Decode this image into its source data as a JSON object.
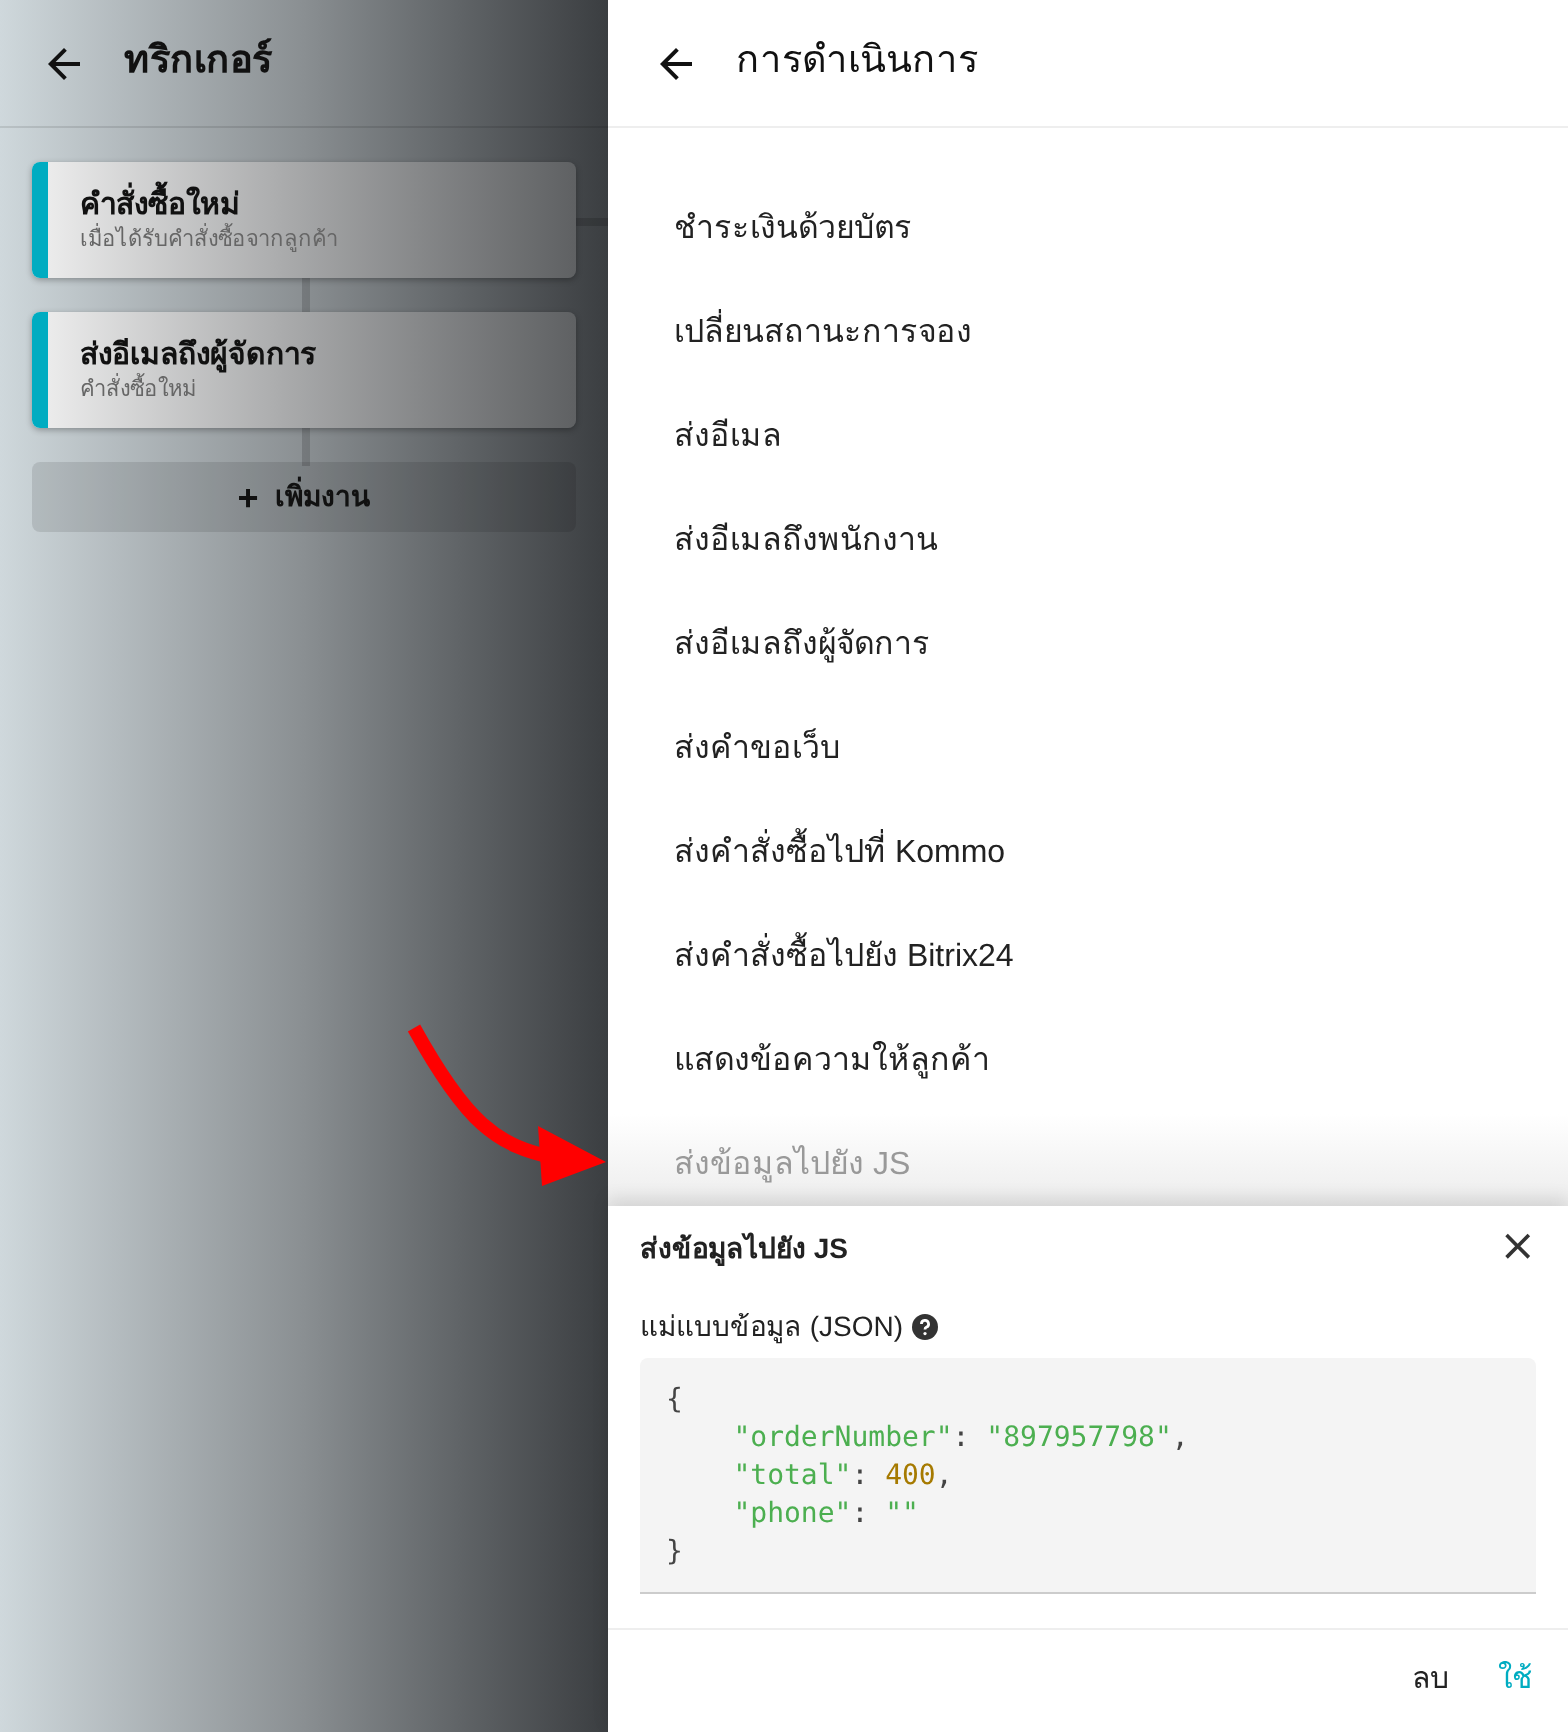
{
  "triggers_panel": {
    "title": "ทริกเกอร์",
    "tasks": [
      {
        "title": "คำสั่งซื้อใหม่",
        "subtitle": "เมื่อได้รับคำสั่งซื้อจากลูกค้า",
        "color": "#00acc1"
      },
      {
        "title": "ส่งอีเมลถึงผู้จัดการ",
        "subtitle": "คำสั่งซื้อใหม่",
        "color": "#00acc1"
      }
    ],
    "add_button": {
      "icon": "+",
      "label": "เพิ่มงาน"
    }
  },
  "actions_panel": {
    "title": "การดำเนินการ",
    "items": [
      {
        "label": "ชำระเงินด้วยบัตร",
        "selected": false
      },
      {
        "label": "เปลี่ยนสถานะการจอง",
        "selected": false
      },
      {
        "label": "ส่งอีเมล",
        "selected": false
      },
      {
        "label": "ส่งอีเมลถึงพนักงาน",
        "selected": false
      },
      {
        "label": "ส่งอีเมลถึงผู้จัดการ",
        "selected": false
      },
      {
        "label": "ส่งคำขอเว็บ",
        "selected": false
      },
      {
        "label": "ส่งคำสั่งซื้อไปที่ Kommo",
        "selected": false
      },
      {
        "label": "ส่งคำสั่งซื้อไปยัง Bitrix24",
        "selected": false
      },
      {
        "label": "แสดงข้อความให้ลูกค้า",
        "selected": false
      },
      {
        "label": "ส่งข้อมูลไปยัง JS",
        "selected": true
      }
    ]
  },
  "dialog": {
    "title": "ส่งข้อมูลไปยัง JS",
    "close": "×",
    "field_label": "แม่แบบข้อมูล (JSON)",
    "code_lines": [
      [
        {
          "kind": "punct",
          "text": "{"
        }
      ],
      [
        {
          "kind": "key",
          "text": "    \"orderNumber\""
        },
        {
          "kind": "punct",
          "text": ": "
        },
        {
          "kind": "string",
          "text": "\"897957798\""
        },
        {
          "kind": "punct",
          "text": ","
        }
      ],
      [
        {
          "kind": "key",
          "text": "    \"total\""
        },
        {
          "kind": "punct",
          "text": ": "
        },
        {
          "kind": "number",
          "text": "400"
        },
        {
          "kind": "punct",
          "text": ","
        }
      ],
      [
        {
          "kind": "key",
          "text": "    \"phone\""
        },
        {
          "kind": "punct",
          "text": ": "
        },
        {
          "kind": "string",
          "text": "\"\""
        }
      ],
      [
        {
          "kind": "punct",
          "text": "}"
        }
      ]
    ],
    "buttons": [
      {
        "label": "ลบ",
        "kind": "secondary"
      },
      {
        "label": "ใช้",
        "kind": "primary"
      }
    ]
  }
}
